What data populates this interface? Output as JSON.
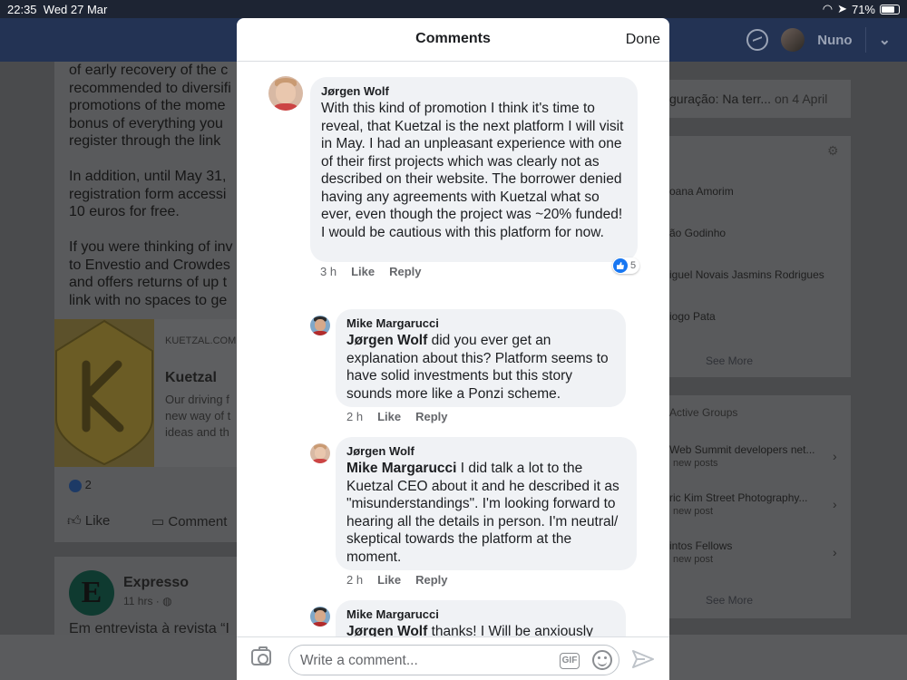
{
  "status_bar": {
    "time": "22:35",
    "date": "Wed 27 Mar",
    "battery": "71%"
  },
  "nav": {
    "user_name": "Nuno"
  },
  "background_post": {
    "text_top": "of early recovery of the c\nrecommended to diversifi\npromotions of the mome\nbonus of everything you \nregister through the link",
    "text_mid": "In addition, until May 31, \nregistration form accessi\n10 euros for free.",
    "text_bot": "If you were thinking of inv\nto Envestio and Crowdes\nand offers returns of up t\nlink with no spaces to ge",
    "link_domain": "KUETZAL.COM",
    "link_title": "Kuetzal",
    "link_desc": "Our driving f\nnew way of t\nideas and th",
    "likes": "2",
    "like_label": "Like",
    "comment_label": "Comment"
  },
  "expresso_post": {
    "page_name": "Expresso",
    "time": "11 hrs",
    "text": "Em entrevista à revista “I"
  },
  "sidebar": {
    "event": "guração: Na terr...",
    "event_date": "on 4 April",
    "people": [
      "oana Amorim",
      "ão Godinho",
      "iguel Novais Jasmins Rodrigues",
      "iogo Pata"
    ],
    "see_more": "See More",
    "groups_title": "Active Groups",
    "groups": [
      {
        "name": "Web Summit developers net...",
        "sub": "new posts"
      },
      {
        "name": "ric Kim Street Photography...",
        "sub": "new post"
      },
      {
        "name": "intos Fellows",
        "sub": "new post"
      }
    ],
    "groups_see_more": "See More"
  },
  "modal": {
    "title": "Comments",
    "done_label": "Done",
    "comments": [
      {
        "author": "Jørgen Wolf",
        "text": "With this kind of promotion I think it's time to reveal, that Kuetzal is the next platform I will visit in May. I had an unpleasant experience with one of their first projects which was clearly not as described on their website. The borrower denied having any agreements with Kuetzal what so ever, even though the project was ~20% funded! I would be cautious with this platform for now.",
        "time": "3 h",
        "like": "Like",
        "reply": "Reply",
        "reactions": "5"
      },
      {
        "author": "Mike Margarucci",
        "mention": "Jørgen Wolf",
        "text": " did you ever get an explanation about this? Platform seems to have solid investments but this story sounds more like a Ponzi scheme.",
        "time": "2 h",
        "like": "Like",
        "reply": "Reply"
      },
      {
        "author": "Jørgen Wolf",
        "mention": "Mike Margarucci",
        "text": " I did talk a lot to the Kuetzal CEO about it and he described it as \"misunderstandings\". I'm looking forward to hearing all the details in person. I'm neutral/ skeptical towards the platform at the moment.",
        "time": "2 h",
        "like": "Like",
        "reply": "Reply"
      },
      {
        "author": "Mike Margarucci",
        "mention": "Jørgen Wolf",
        "text": " thanks!  I Will be anxiously awaiting your visit report. Btw to someone"
      }
    ],
    "composer": {
      "placeholder": "Write a comment...",
      "gif_label": "GIF"
    }
  }
}
